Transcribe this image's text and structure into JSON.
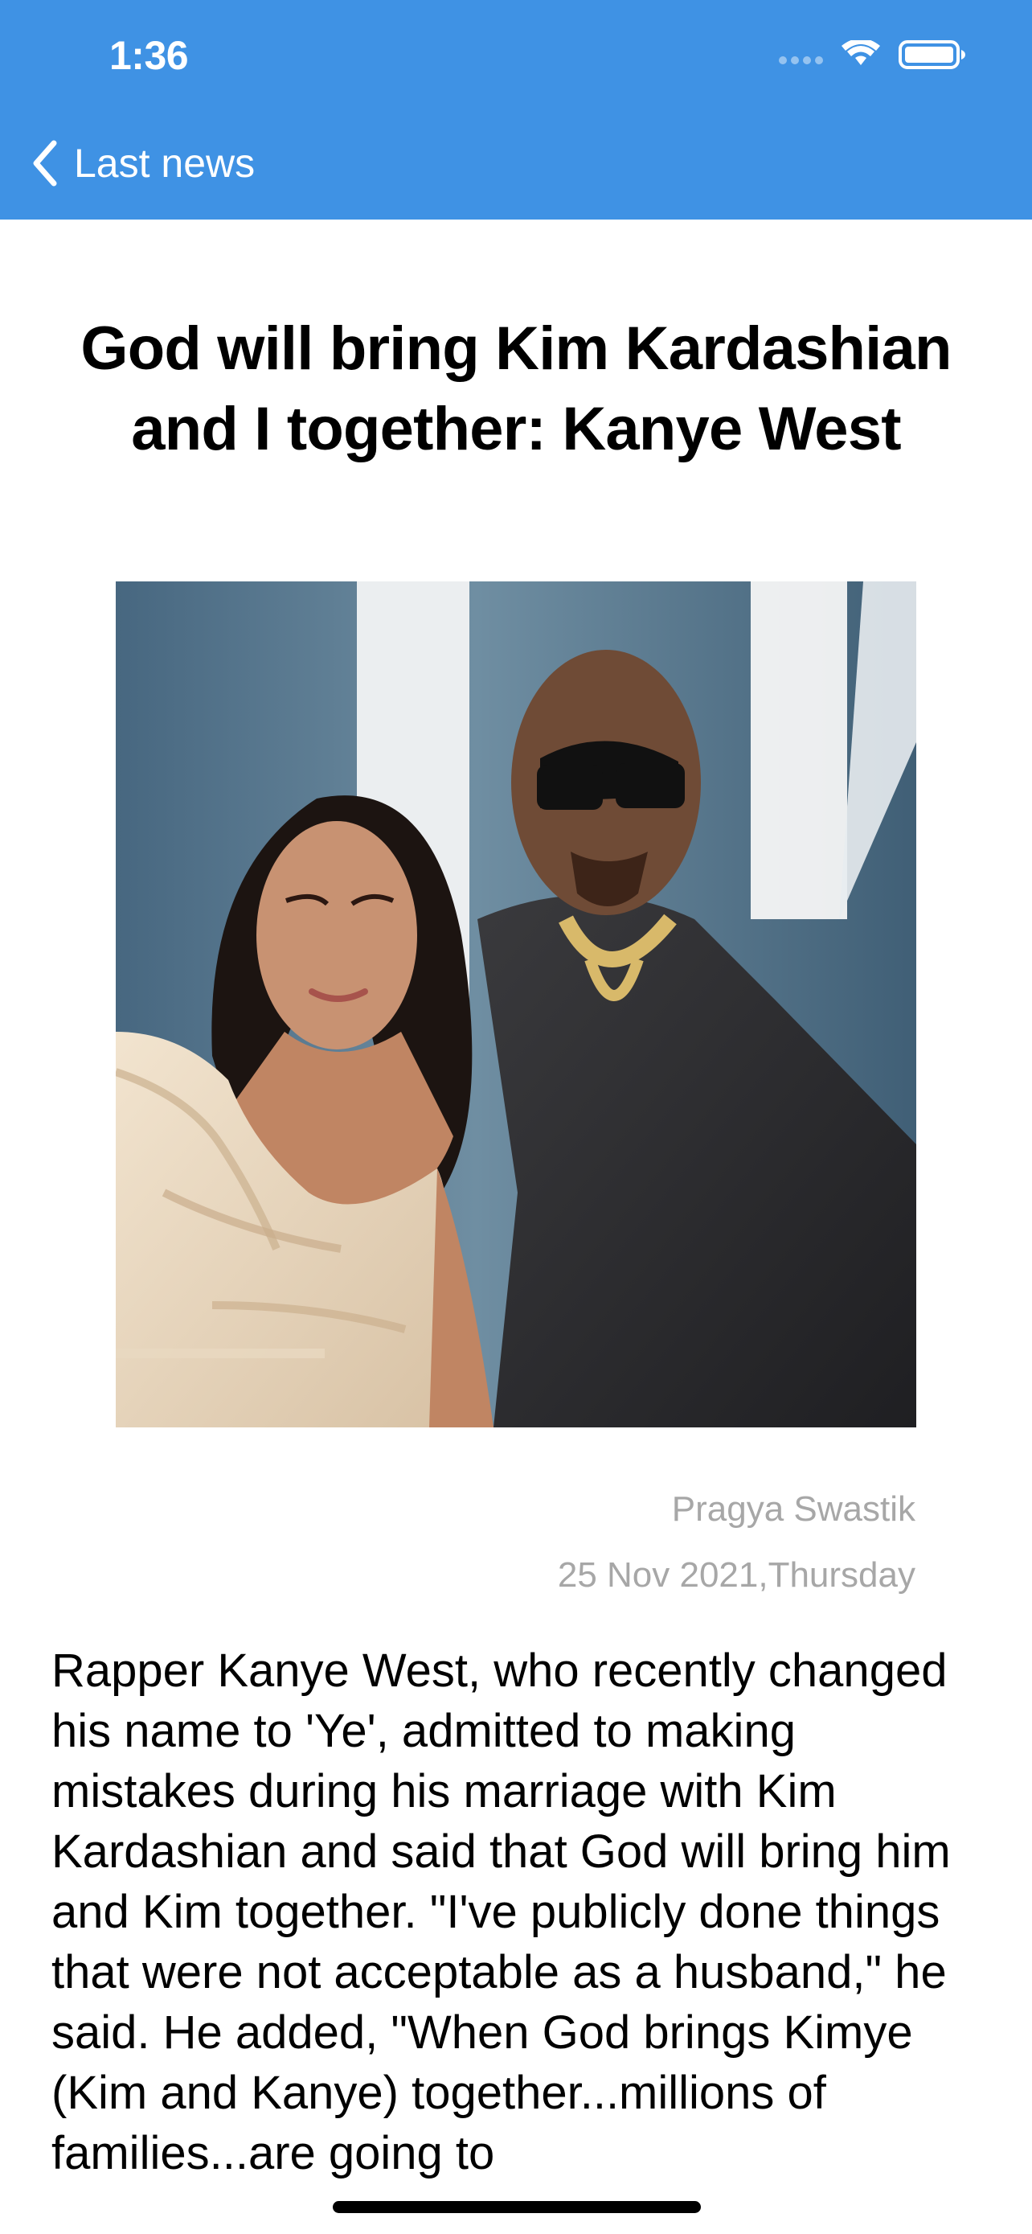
{
  "status_bar": {
    "time": "1:36",
    "icons": [
      "cellular-signal-icon",
      "wifi-icon",
      "battery-icon"
    ]
  },
  "nav": {
    "back_label": "Last news",
    "back_icon": "chevron-left-icon"
  },
  "article": {
    "title": "God will bring Kim Kardashian and I together: Kanye West",
    "image_alt": "Kim Kardashian and Kanye West photo",
    "author": "Pragya Swastik",
    "date": "25 Nov 2021,Thursday",
    "body": "Rapper Kanye West, who recently changed his name to 'Ye', admitted to making mistakes during his marriage with Kim Kardashian and said that God will bring him and Kim together. \"I've publicly done things that were not acceptable as a husband,\" he said. He added, \"When God brings Kimye (Kim and Kanye) together...millions of families...are going to"
  },
  "colors": {
    "header_blue": "#3f92e4",
    "meta_gray": "#a7a7a7",
    "text_black": "#000000"
  }
}
